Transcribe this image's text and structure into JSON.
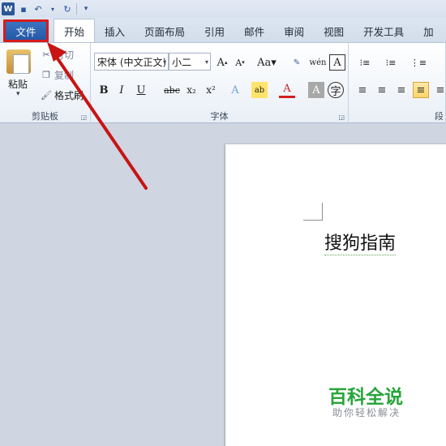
{
  "quick_access": {
    "app_icon": "W"
  },
  "tabs": [
    {
      "label": "文件"
    },
    {
      "label": "开始"
    },
    {
      "label": "插入"
    },
    {
      "label": "页面布局"
    },
    {
      "label": "引用"
    },
    {
      "label": "邮件"
    },
    {
      "label": "审阅"
    },
    {
      "label": "视图"
    },
    {
      "label": "开发工具"
    },
    {
      "label": "加"
    }
  ],
  "clipboard": {
    "paste_label": "粘贴",
    "cut_label": "剪切",
    "copy_label": "复制",
    "format_painter_label": "格式刷",
    "group_label": "剪贴板"
  },
  "font": {
    "font_name": "宋体 (中文正文)",
    "font_size": "小二",
    "group_label": "字体"
  },
  "paragraph": {
    "group_label": "段"
  },
  "document": {
    "text": "搜狗指南"
  },
  "watermark": {
    "title": "百科全说",
    "subtitle": "助你轻松解决"
  },
  "colors": {
    "highlight_box": "#d81b1b",
    "arrow": "#c81414",
    "file_tab": "#2b65b7"
  }
}
